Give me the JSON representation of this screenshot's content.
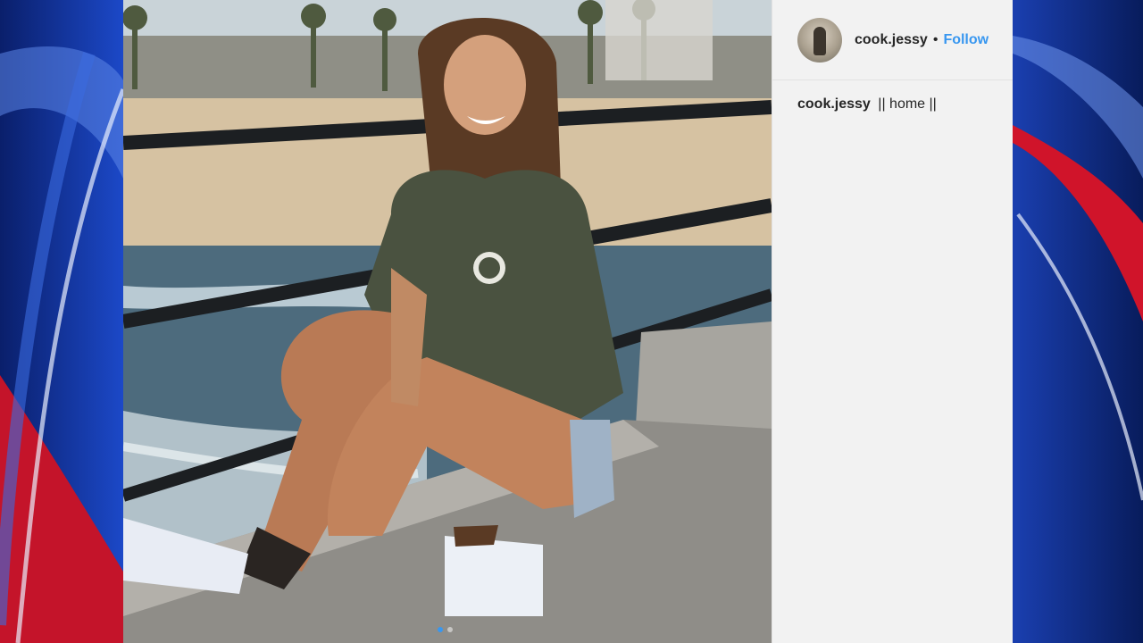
{
  "post": {
    "username": "cook.jessy",
    "separator": "•",
    "follow_label": "Follow",
    "caption_user": "cook.jessy",
    "caption_text": "|| home ||"
  },
  "colors": {
    "follow_blue": "#3897f0",
    "broadcast_blue": "#0b2a8a",
    "broadcast_red": "#d0142a"
  },
  "carousel": {
    "slide_count": 2,
    "active_index": 0
  }
}
